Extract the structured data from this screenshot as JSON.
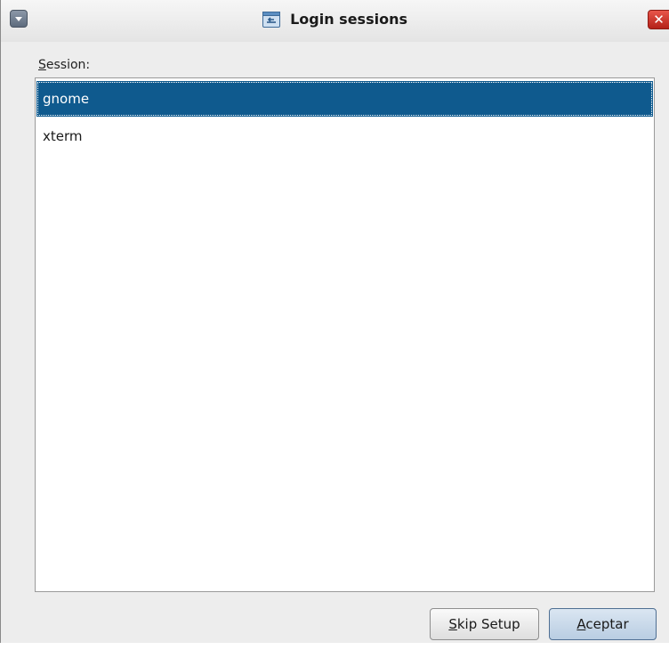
{
  "window": {
    "title": "Login sessions",
    "close_glyph": "✕",
    "icons": {
      "menu": "window-menu-icon",
      "app": "app-window-icon",
      "close": "close-icon"
    }
  },
  "form": {
    "session_label_mnemonic": "S",
    "session_label_rest": "ession:"
  },
  "sessions": {
    "items": [
      {
        "label": "gnome",
        "selected": true
      },
      {
        "label": "xterm",
        "selected": false
      }
    ]
  },
  "buttons": {
    "skip_mnemonic": "S",
    "skip_rest": "kip Setup",
    "accept_mnemonic": "A",
    "accept_rest": "ceptar"
  },
  "colors": {
    "selection": "#0f5a8e",
    "close": "#c8322a",
    "window_bg": "#ededed"
  }
}
